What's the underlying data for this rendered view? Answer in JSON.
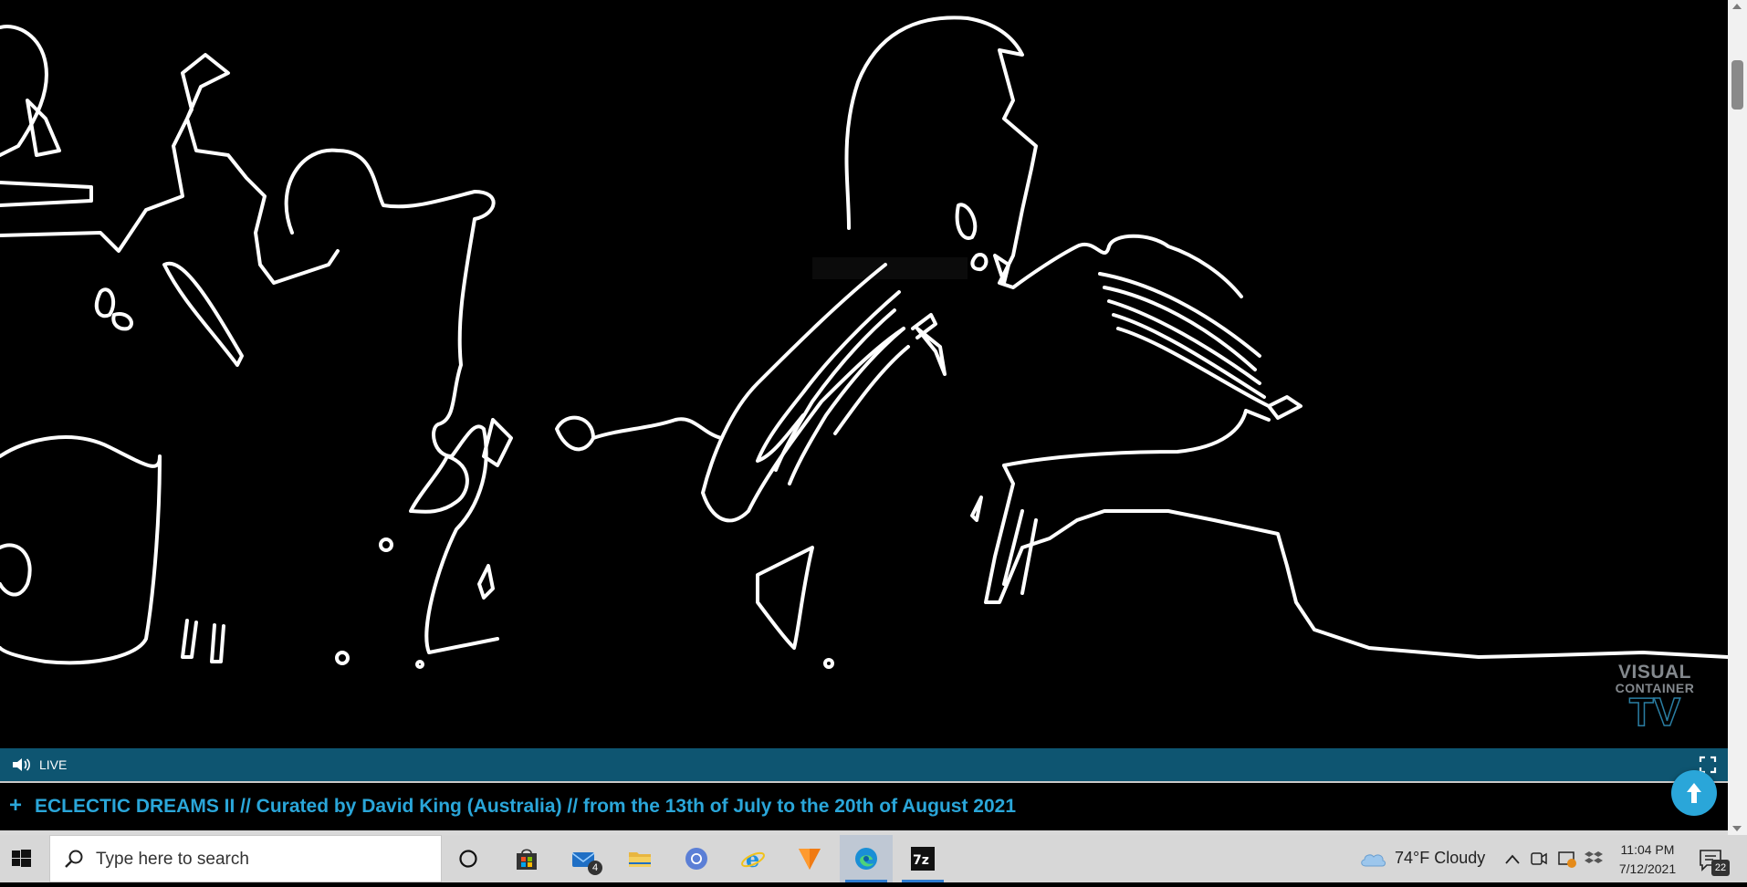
{
  "player": {
    "live_label": "LIVE",
    "watermark": {
      "line1": "VISUAL",
      "line2": "CONTAINER",
      "line3": "TV"
    }
  },
  "banner": {
    "plus": "+",
    "text": "ECLECTIC DREAMS II // Curated by David King (Australia) // from the 13th of July to the 20th of August 2021"
  },
  "taskbar": {
    "search_placeholder": "Type here to search",
    "mail_badge": "4",
    "weather": "74°F  Cloudy",
    "time": "11:04 PM",
    "date": "7/12/2021",
    "notifications": "22"
  },
  "colors": {
    "accent": "#2aa6d9",
    "player_bar": "#0e5571"
  }
}
